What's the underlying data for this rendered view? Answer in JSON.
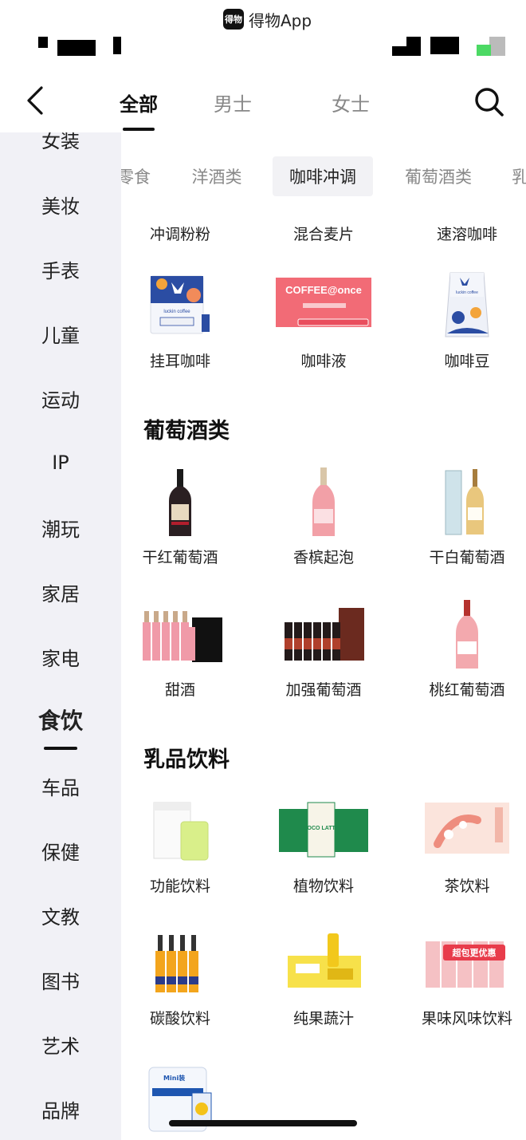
{
  "app_banner": {
    "logo_text": "得物",
    "name": "得物App"
  },
  "nav": {
    "tabs": [
      {
        "label": "全部",
        "active": true
      },
      {
        "label": "男士",
        "active": false
      },
      {
        "label": "女士",
        "active": false
      }
    ]
  },
  "sidebar": {
    "items": [
      {
        "label": "女装"
      },
      {
        "label": "美妆"
      },
      {
        "label": "手表"
      },
      {
        "label": "儿童"
      },
      {
        "label": "运动"
      },
      {
        "label": "IP"
      },
      {
        "label": "潮玩"
      },
      {
        "label": "家居"
      },
      {
        "label": "家电"
      },
      {
        "label": "食饮",
        "active": true
      },
      {
        "label": "车品"
      },
      {
        "label": "保健"
      },
      {
        "label": "文教"
      },
      {
        "label": "图书"
      },
      {
        "label": "艺术"
      },
      {
        "label": "品牌"
      }
    ]
  },
  "subtabs": [
    {
      "label": "零食"
    },
    {
      "label": "洋酒类"
    },
    {
      "label": "咖啡冲调",
      "active": true
    },
    {
      "label": "葡萄酒类"
    },
    {
      "label": "乳"
    }
  ],
  "coffee_partial_labels": [
    "冲调粉粉",
    "混合麦片",
    "速溶咖啡"
  ],
  "coffee_items": [
    {
      "label": "挂耳咖啡",
      "thumb_text": "luckin coffee"
    },
    {
      "label": "咖啡液",
      "thumb_text": "COFFEE@once"
    },
    {
      "label": "咖啡豆",
      "thumb_text": "luckin coffee"
    }
  ],
  "sections": [
    {
      "title": "葡萄酒类",
      "items": [
        {
          "label": "干红葡萄酒"
        },
        {
          "label": "香槟起泡"
        },
        {
          "label": "干白葡萄酒"
        },
        {
          "label": "甜酒"
        },
        {
          "label": "加强葡萄酒"
        },
        {
          "label": "桃红葡萄酒"
        }
      ]
    },
    {
      "title": "乳品饮料",
      "items": [
        {
          "label": "功能饮料"
        },
        {
          "label": "植物饮料",
          "thumb_text": "COCO LATTE"
        },
        {
          "label": "茶饮料"
        },
        {
          "label": "碳酸饮料"
        },
        {
          "label": "纯果蔬汁"
        },
        {
          "label": "果味风味饮料",
          "thumb_text": "超包更优惠"
        },
        {
          "label": "",
          "thumb_text": "Mini装"
        }
      ]
    }
  ],
  "colors": {
    "sidebar_bg": "#f1f1f6",
    "active_text": "#111111",
    "inactive_text": "#888888",
    "subtab_active_bg": "#f2f2f5"
  }
}
